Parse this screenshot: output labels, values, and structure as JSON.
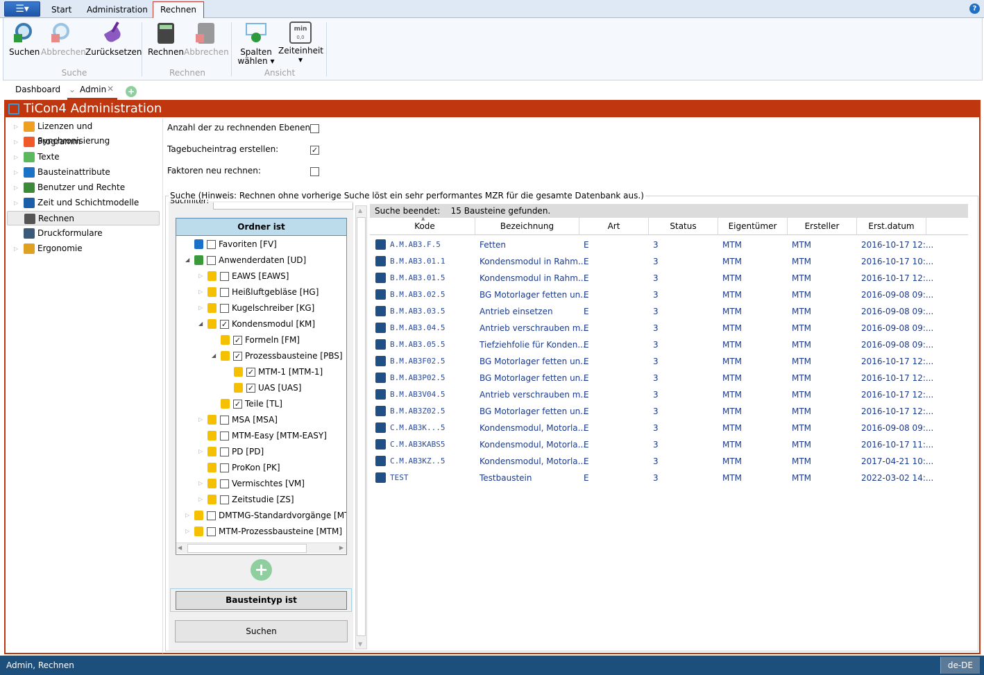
{
  "ribbon_tabs": [
    "Start",
    "Administration",
    "Rechnen"
  ],
  "active_ribbon_tab": "Rechnen",
  "help_label": "?",
  "ribbon": {
    "groups": [
      {
        "label": "Suche",
        "buttons": [
          {
            "label": "Suchen",
            "enabled": true,
            "icon": "search-play-icon"
          },
          {
            "label": "Abbrechen",
            "enabled": false,
            "icon": "search-stop-icon"
          },
          {
            "label": "Zurücksetzen",
            "enabled": true,
            "icon": "broom-icon"
          }
        ]
      },
      {
        "label": "Rechnen",
        "buttons": [
          {
            "label": "Rechnen",
            "enabled": true,
            "icon": "calculator-icon"
          },
          {
            "label": "Abbrechen",
            "enabled": false,
            "icon": "calculator-stop-icon"
          }
        ]
      },
      {
        "label": "Ansicht",
        "buttons": [
          {
            "label": "Spalten",
            "label2": "wählen ▾",
            "enabled": true,
            "icon": "columns-check-icon"
          },
          {
            "label": "Zeiteinheit",
            "label2": "▾",
            "enabled": true,
            "icon": "time-unit-icon",
            "icon_text": "min",
            "icon_sub": "0,0"
          }
        ]
      }
    ]
  },
  "doc_tabs": [
    "Dashboard",
    "Admin"
  ],
  "header_title": "TiCon4 Administration",
  "nav": [
    {
      "label": "Lizenzen und Synchronisierung",
      "expandable": true,
      "color": "#f0a020"
    },
    {
      "label": "Programm",
      "expandable": true,
      "color": "#f05a28"
    },
    {
      "label": "Texte",
      "expandable": true,
      "color": "#5cb85c"
    },
    {
      "label": "Bausteinattribute",
      "expandable": true,
      "color": "#1a73c8"
    },
    {
      "label": "Benutzer und Rechte",
      "expandable": true,
      "color": "#3a8a3a"
    },
    {
      "label": "Zeit und Schichtmodelle",
      "expandable": true,
      "color": "#1a5fa8"
    },
    {
      "label": "Rechnen",
      "expandable": false,
      "selected": true,
      "color": "#555555"
    },
    {
      "label": "Druckformulare",
      "expandable": false,
      "color": "#3a5a7a"
    },
    {
      "label": "Ergonomie",
      "expandable": true,
      "color": "#e0a020"
    }
  ],
  "options": [
    {
      "label": "Anzahl der zu rechnenden Ebenen:",
      "checked": false
    },
    {
      "label": "Tagebucheintrag erstellen:",
      "checked": true
    },
    {
      "label": "Faktoren neu rechnen:",
      "checked": false
    }
  ],
  "search_group_label": "Suche (Hinweis: Rechnen ohne vorherige Suche löst ein sehr performantes MZR für die gesamte Datenbank aus.)",
  "filter": {
    "suchfilter_label": "Suchfilter:",
    "folder_header": "Ordner ist",
    "tree": [
      {
        "label": "Favoriten [FV]",
        "level": 0,
        "exp": "",
        "checked": false,
        "color": "#1a6fc8"
      },
      {
        "label": "Anwenderdaten [UD]",
        "level": 0,
        "exp": "◢",
        "checked": false,
        "color": "#3a9a3a"
      },
      {
        "label": "EAWS [EAWS]",
        "level": 1,
        "exp": "▷",
        "checked": false,
        "color": "#f5c000"
      },
      {
        "label": "Heißluftgebläse [HG]",
        "level": 1,
        "exp": "▷",
        "checked": false,
        "color": "#f5c000"
      },
      {
        "label": "Kugelschreiber [KG]",
        "level": 1,
        "exp": "▷",
        "checked": false,
        "color": "#f5c000"
      },
      {
        "label": "Kondensmodul [KM]",
        "level": 1,
        "exp": "◢",
        "checked": true,
        "color": "#f5c000"
      },
      {
        "label": "Formeln [FM]",
        "level": 2,
        "exp": "",
        "checked": true,
        "color": "#f5c000"
      },
      {
        "label": "Prozessbausteine [PBS]",
        "level": 2,
        "exp": "◢",
        "checked": true,
        "color": "#f5c000"
      },
      {
        "label": "MTM-1 [MTM-1]",
        "level": 3,
        "exp": "",
        "checked": true,
        "color": "#f5c000"
      },
      {
        "label": "UAS [UAS]",
        "level": 3,
        "exp": "",
        "checked": true,
        "color": "#f5c000"
      },
      {
        "label": "Teile [TL]",
        "level": 2,
        "exp": "",
        "checked": true,
        "color": "#f5c000"
      },
      {
        "label": "MSA [MSA]",
        "level": 1,
        "exp": "▷",
        "checked": false,
        "color": "#f5c000"
      },
      {
        "label": "MTM-Easy [MTM-EASY]",
        "level": 1,
        "exp": "",
        "checked": false,
        "color": "#f5c000"
      },
      {
        "label": "PD [PD]",
        "level": 1,
        "exp": "▷",
        "checked": false,
        "color": "#f5c000"
      },
      {
        "label": "ProKon [PK]",
        "level": 1,
        "exp": "",
        "checked": false,
        "color": "#f5c000"
      },
      {
        "label": "Vermischtes [VM]",
        "level": 1,
        "exp": "▷",
        "checked": false,
        "color": "#f5c000"
      },
      {
        "label": "Zeitstudie [ZS]",
        "level": 1,
        "exp": "▷",
        "checked": false,
        "color": "#f5c000"
      },
      {
        "label": "DMTMG-Standardvorgänge [MTM-",
        "level": 0,
        "exp": "▷",
        "checked": false,
        "color": "#f5c000"
      },
      {
        "label": "MTM-Prozessbausteine [MTM]",
        "level": 0,
        "exp": "▷",
        "checked": false,
        "color": "#f5c000"
      }
    ],
    "type_header": "Bausteintyp ist",
    "search_button": "Suchen"
  },
  "results": {
    "status_label": "Suche beendet:",
    "status_value": "15 Bausteine gefunden.",
    "columns": [
      "Kode",
      "Bezeichnung",
      "Art",
      "Status",
      "Eigentümer",
      "Ersteller",
      "Erst.datum"
    ],
    "sorted_column": "Kode",
    "rows": [
      [
        "A.M.AB3.F.5",
        "Fetten",
        "E",
        "3",
        "MTM",
        "MTM",
        "2016-10-17 12:..."
      ],
      [
        "B.M.AB3.01.1",
        "Kondensmodul in Rahm...",
        "E",
        "3",
        "MTM",
        "MTM",
        "2016-10-17 10:..."
      ],
      [
        "B.M.AB3.01.5",
        "Kondensmodul in Rahm...",
        "E",
        "3",
        "MTM",
        "MTM",
        "2016-10-17 12:..."
      ],
      [
        "B.M.AB3.02.5",
        "BG Motorlager fetten un...",
        "E",
        "3",
        "MTM",
        "MTM",
        "2016-09-08 09:..."
      ],
      [
        "B.M.AB3.03.5",
        "Antrieb einsetzen",
        "E",
        "3",
        "MTM",
        "MTM",
        "2016-09-08 09:..."
      ],
      [
        "B.M.AB3.04.5",
        "Antrieb verschrauben m...",
        "E",
        "3",
        "MTM",
        "MTM",
        "2016-09-08 09:..."
      ],
      [
        "B.M.AB3.05.5",
        "Tiefziehfolie für Konden...",
        "E",
        "3",
        "MTM",
        "MTM",
        "2016-09-08 09:..."
      ],
      [
        "B.M.AB3F02.5",
        "BG Motorlager fetten un...",
        "E",
        "3",
        "MTM",
        "MTM",
        "2016-10-17 12:..."
      ],
      [
        "B.M.AB3P02.5",
        "BG Motorlager fetten un...",
        "E",
        "3",
        "MTM",
        "MTM",
        "2016-10-17 12:..."
      ],
      [
        "B.M.AB3V04.5",
        "Antrieb verschrauben m...",
        "E",
        "3",
        "MTM",
        "MTM",
        "2016-10-17 12:..."
      ],
      [
        "B.M.AB3Z02.5",
        "BG Motorlager fetten un...",
        "E",
        "3",
        "MTM",
        "MTM",
        "2016-10-17 12:..."
      ],
      [
        "C.M.AB3K...5",
        "Kondensmodul, Motorla...",
        "E",
        "3",
        "MTM",
        "MTM",
        "2016-09-08 09:..."
      ],
      [
        "C.M.AB3KABS5",
        "Kondensmodul, Motorla...",
        "E",
        "3",
        "MTM",
        "MTM",
        "2016-10-17 11:..."
      ],
      [
        "C.M.AB3KZ..5",
        "Kondensmodul, Motorla...",
        "E",
        "3",
        "MTM",
        "MTM",
        "2017-04-21 10:..."
      ],
      [
        "TEST",
        "Testbaustein",
        "E",
        "3",
        "MTM",
        "MTM",
        "2022-03-02 14:..."
      ]
    ]
  },
  "statusbar": {
    "text": "Admin, Rechnen",
    "language": "de-DE"
  }
}
